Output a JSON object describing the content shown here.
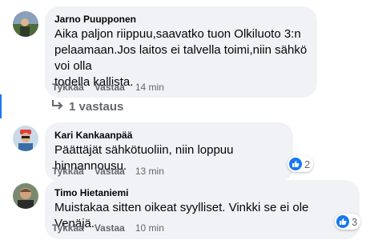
{
  "comments": [
    {
      "author": "Jarno Puupponen",
      "text": "Aika paljon riippuu,saavatko tuon Olkiluoto 3:n\npelaamaan.Jos laitos ei talvella toimi,niin sähkö voi olla\ntodella kallista.",
      "like_label": "Tykkää",
      "reply_label": "Vastaa",
      "time": "14 min"
    },
    {
      "author": "Kari Kankaanpää",
      "text": "Päättäjät sähkötuoliin, niin loppuu hinnannousu.",
      "like_label": "Tykkää",
      "reply_label": "Vastaa",
      "time": "13 min",
      "reaction_count": "2"
    },
    {
      "author": "Timo Hietaniemi",
      "text": "Muistakaa sitten oikeat syylliset. Vinkki se ei ole Venäjä.",
      "like_label": "Tykkää",
      "reply_label": "Vastaa",
      "time": "10 min",
      "reaction_count": "3"
    }
  ],
  "replies_link": "1 vastaus",
  "colors": {
    "bubble": "#f0f2f5",
    "secondary_text": "#65676b",
    "accent": "#1877f2"
  }
}
